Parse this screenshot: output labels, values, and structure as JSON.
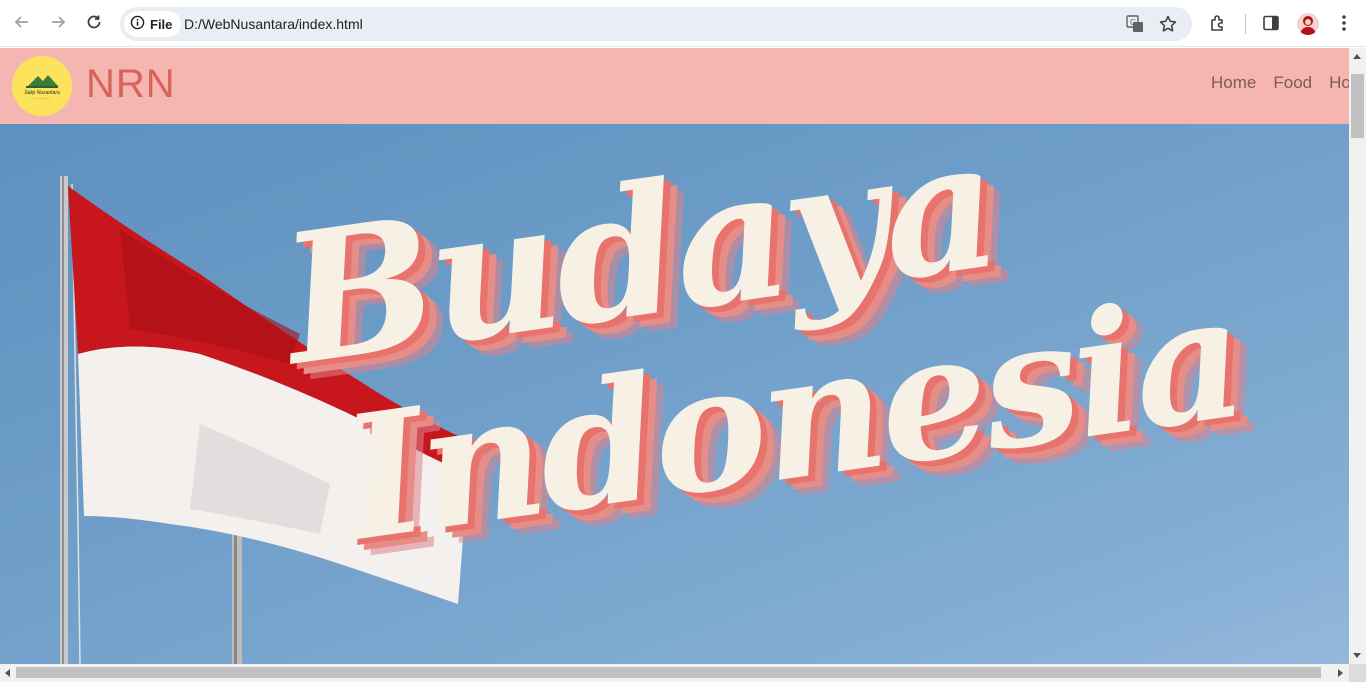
{
  "browser": {
    "chip_label": "File",
    "url": "D:/WebNusantara/index.html"
  },
  "site": {
    "logo_text": "Salip Nusantara",
    "brand": "NRN",
    "nav": [
      "Home",
      "Food",
      "Hou"
    ]
  },
  "hero": {
    "title_line1": "Budaya",
    "title_line2": "Indonesia"
  },
  "colors": {
    "header_bg": "#f5b6b1",
    "brand": "#d9635b",
    "sky": "#6d9dc8",
    "title_fill": "#f7f1e5",
    "title_shadow": "#e8736c",
    "flag_red": "#c8161d",
    "flag_white": "#f3f0ee"
  },
  "icons": [
    "back-icon",
    "forward-icon",
    "reload-icon",
    "info-icon",
    "translate-icon",
    "star-icon",
    "extensions-icon",
    "side-panel-icon",
    "menu-icon"
  ]
}
